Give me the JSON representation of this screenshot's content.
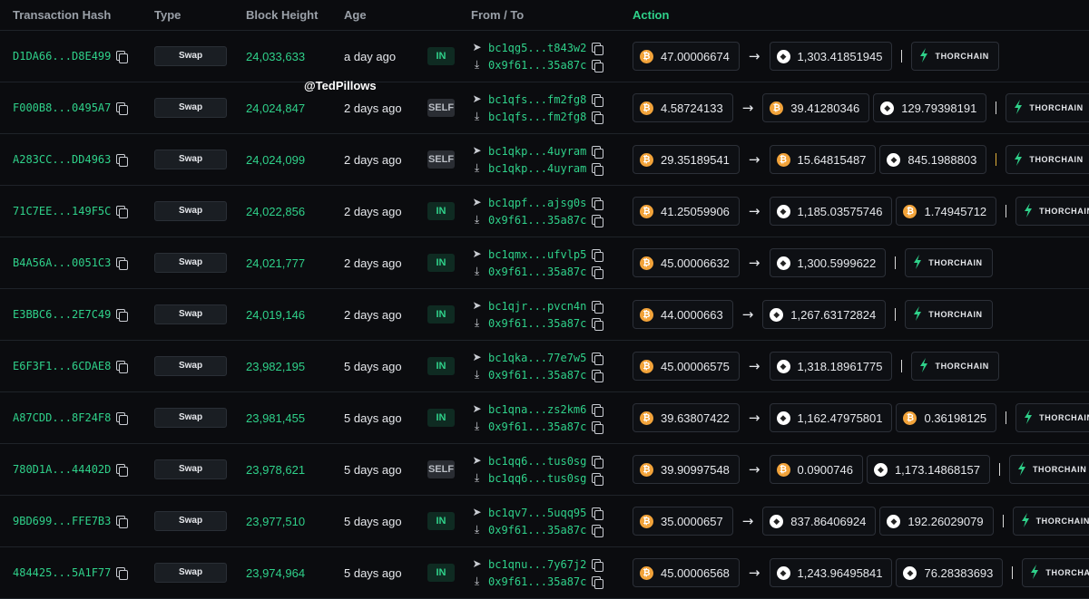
{
  "header": {
    "hash": "Transaction Hash",
    "type": "Type",
    "block": "Block Height",
    "age": "Age",
    "fromto": "From / To",
    "action": "Action"
  },
  "watermark": "@TedPillows",
  "colors": {
    "accent": "#2fd18a",
    "btc": "#f2a33a",
    "eth": "#ffffff",
    "bg": "#0b0c0f"
  },
  "rows": [
    {
      "hash": "D1DA66...D8E499",
      "type": "Swap",
      "block": "24,033,633",
      "age": "a day ago",
      "dir": "IN",
      "from": "bc1qg5...t843w2",
      "to": "0x9f61...35a87c",
      "assets": [
        {
          "coin": "btc",
          "amount": "47.00006674"
        },
        {
          "coin": "eth",
          "amount": "1,303.41851945"
        }
      ],
      "split": 1,
      "sep_color": "white"
    },
    {
      "hash": "F000B8...0495A7",
      "type": "Swap",
      "block": "24,024,847",
      "age": "2 days ago",
      "dir": "SELF",
      "from": "bc1qfs...fm2fg8",
      "to": "bc1qfs...fm2fg8",
      "assets": [
        {
          "coin": "btc",
          "amount": "4.58724133"
        },
        {
          "coin": "btc",
          "amount": "39.41280346"
        },
        {
          "coin": "eth",
          "amount": "129.79398191"
        }
      ],
      "split": 1,
      "sep_color": "white"
    },
    {
      "hash": "A283CC...DD4963",
      "type": "Swap",
      "block": "24,024,099",
      "age": "2 days ago",
      "dir": "SELF",
      "from": "bc1qkp...4uyram",
      "to": "bc1qkp...4uyram",
      "assets": [
        {
          "coin": "btc",
          "amount": "29.35189541"
        },
        {
          "coin": "btc",
          "amount": "15.64815487"
        },
        {
          "coin": "eth",
          "amount": "845.1988803"
        }
      ],
      "split": 1,
      "sep_color": "gold"
    },
    {
      "hash": "71C7EE...149F5C",
      "type": "Swap",
      "block": "24,022,856",
      "age": "2 days ago",
      "dir": "IN",
      "from": "bc1qpf...ajsg0s",
      "to": "0x9f61...35a87c",
      "assets": [
        {
          "coin": "btc",
          "amount": "41.25059906"
        },
        {
          "coin": "eth",
          "amount": "1,185.03575746"
        },
        {
          "coin": "btc",
          "amount": "1.74945712"
        }
      ],
      "split": 1,
      "sep_color": "white"
    },
    {
      "hash": "B4A56A...0051C3",
      "type": "Swap",
      "block": "24,021,777",
      "age": "2 days ago",
      "dir": "IN",
      "from": "bc1qmx...ufvlp5",
      "to": "0x9f61...35a87c",
      "assets": [
        {
          "coin": "btc",
          "amount": "45.00006632"
        },
        {
          "coin": "eth",
          "amount": "1,300.5999622"
        }
      ],
      "split": 1,
      "sep_color": "white"
    },
    {
      "hash": "E3BBC6...2E7C49",
      "type": "Swap",
      "block": "24,019,146",
      "age": "2 days ago",
      "dir": "IN",
      "from": "bc1qjr...pvcn4n",
      "to": "0x9f61...35a87c",
      "assets": [
        {
          "coin": "btc",
          "amount": "44.0000663"
        },
        {
          "coin": "eth",
          "amount": "1,267.63172824"
        }
      ],
      "split": 1,
      "sep_color": "white"
    },
    {
      "hash": "E6F3F1...6CDAE8",
      "type": "Swap",
      "block": "23,982,195",
      "age": "5 days ago",
      "dir": "IN",
      "from": "bc1qka...77e7w5",
      "to": "0x9f61...35a87c",
      "assets": [
        {
          "coin": "btc",
          "amount": "45.00006575"
        },
        {
          "coin": "eth",
          "amount": "1,318.18961775"
        }
      ],
      "split": 1,
      "sep_color": "white"
    },
    {
      "hash": "A87CDD...8F24F8",
      "type": "Swap",
      "block": "23,981,455",
      "age": "5 days ago",
      "dir": "IN",
      "from": "bc1qna...zs2km6",
      "to": "0x9f61...35a87c",
      "assets": [
        {
          "coin": "btc",
          "amount": "39.63807422"
        },
        {
          "coin": "eth",
          "amount": "1,162.47975801"
        },
        {
          "coin": "btc",
          "amount": "0.36198125"
        }
      ],
      "split": 1,
      "sep_color": "white"
    },
    {
      "hash": "780D1A...44402D",
      "type": "Swap",
      "block": "23,978,621",
      "age": "5 days ago",
      "dir": "SELF",
      "from": "bc1qq6...tus0sg",
      "to": "bc1qq6...tus0sg",
      "assets": [
        {
          "coin": "btc",
          "amount": "39.90997548"
        },
        {
          "coin": "btc",
          "amount": "0.0900746"
        },
        {
          "coin": "eth",
          "amount": "1,173.14868157"
        }
      ],
      "split": 1,
      "sep_color": "white"
    },
    {
      "hash": "9BD699...FFE7B3",
      "type": "Swap",
      "block": "23,977,510",
      "age": "5 days ago",
      "dir": "IN",
      "from": "bc1qv7...5uqq95",
      "to": "0x9f61...35a87c",
      "assets": [
        {
          "coin": "btc",
          "amount": "35.0000657"
        },
        {
          "coin": "eth",
          "amount": "837.86406924"
        },
        {
          "coin": "eth",
          "amount": "192.26029079"
        }
      ],
      "split": 1,
      "sep_color": "white"
    },
    {
      "hash": "484425...5A1F77",
      "type": "Swap",
      "block": "23,974,964",
      "age": "5 days ago",
      "dir": "IN",
      "from": "bc1qnu...7y67j2",
      "to": "0x9f61...35a87c",
      "assets": [
        {
          "coin": "btc",
          "amount": "45.00006568"
        },
        {
          "coin": "eth",
          "amount": "1,243.96495841"
        },
        {
          "coin": "eth",
          "amount": "76.28383693"
        }
      ],
      "split": 1,
      "sep_color": "white"
    }
  ],
  "protocol": {
    "name": "THORCHAIN",
    "icon": "thorchain-logo-icon"
  }
}
